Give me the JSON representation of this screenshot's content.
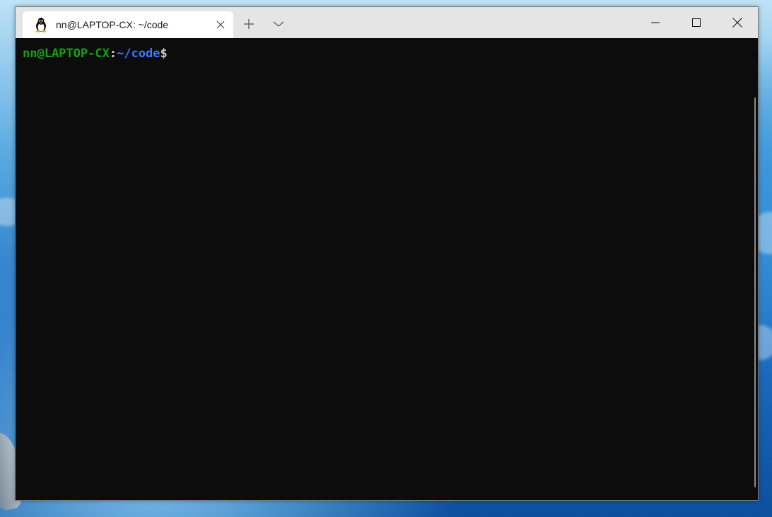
{
  "window": {
    "tab_title": "nn@LAPTOP-CX: ~/code",
    "tab_icon": "linux-penguin-icon"
  },
  "terminal": {
    "prompt": {
      "user_host": "nn@LAPTOP-CX",
      "colon": ":",
      "path": "~/code",
      "symbol": "$"
    }
  },
  "colors": {
    "user_host": "#13a10e",
    "path": "#3b78ff",
    "terminal_bg": "#0c0c0c",
    "titlebar_bg": "#e5e5e5"
  }
}
